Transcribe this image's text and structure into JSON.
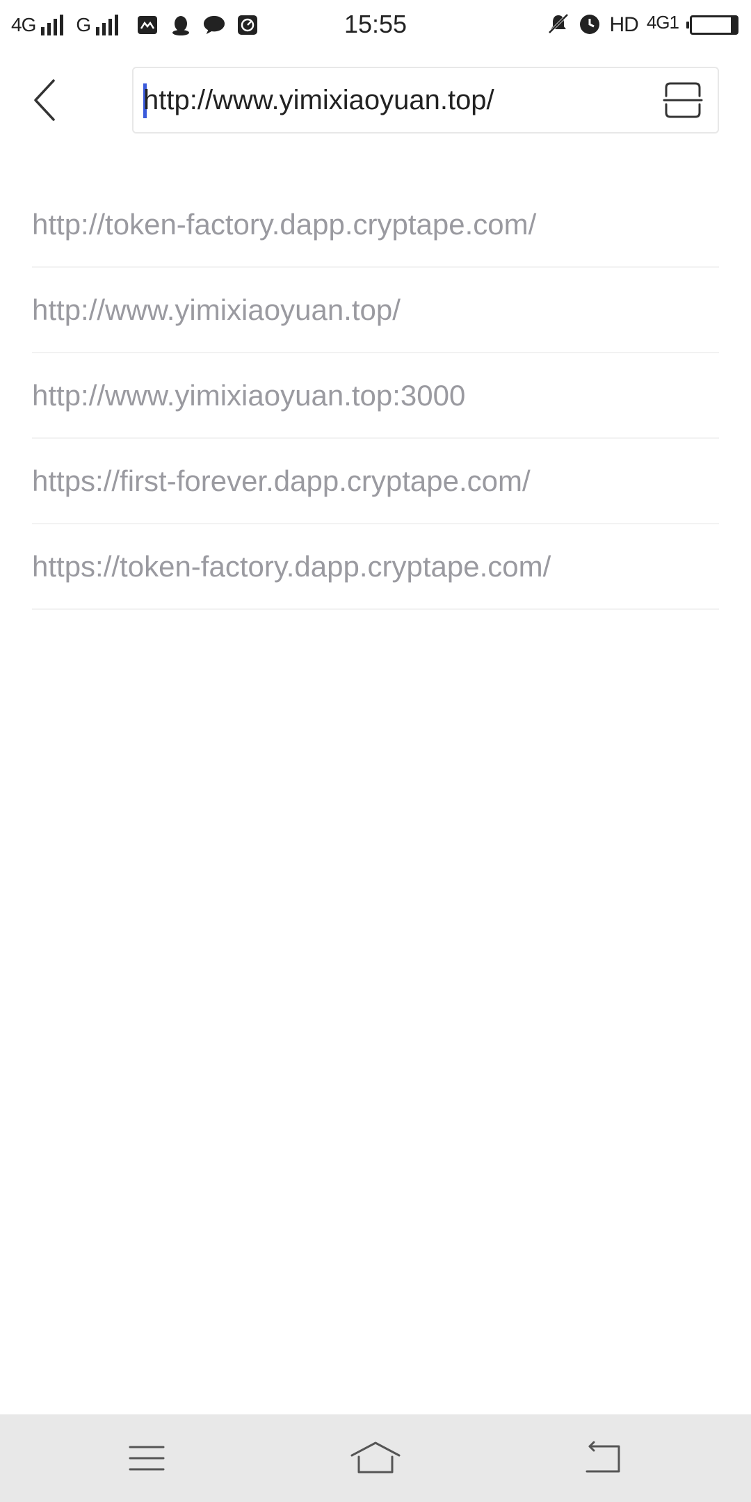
{
  "status_bar": {
    "network_1": "4G",
    "network_2": "G",
    "time": "15:55",
    "hd_label": "HD",
    "network_right": "4G1",
    "icons": [
      "signal-icon",
      "signal-icon",
      "mail-icon",
      "qq-icon",
      "chat-icon",
      "app-icon",
      "mute-icon",
      "alarm-icon",
      "battery-icon"
    ]
  },
  "toolbar": {
    "back_icon": "chevron-left-icon",
    "url_value": "http://www.yimixiaoyuan.top/",
    "scan_icon": "scan-icon"
  },
  "suggestions": [
    "http://token-factory.dapp.cryptape.com/",
    "http://www.yimixiaoyuan.top/",
    "http://www.yimixiaoyuan.top:3000",
    "https://first-forever.dapp.cryptape.com/",
    "https://token-factory.dapp.cryptape.com/"
  ],
  "nav_bar": {
    "icons": [
      "menu-icon",
      "home-icon",
      "back-icon"
    ]
  },
  "colors": {
    "caret": "#3b5bdb",
    "suggestion_text": "#9a9aa0",
    "nav_background": "#e8e8e8"
  }
}
